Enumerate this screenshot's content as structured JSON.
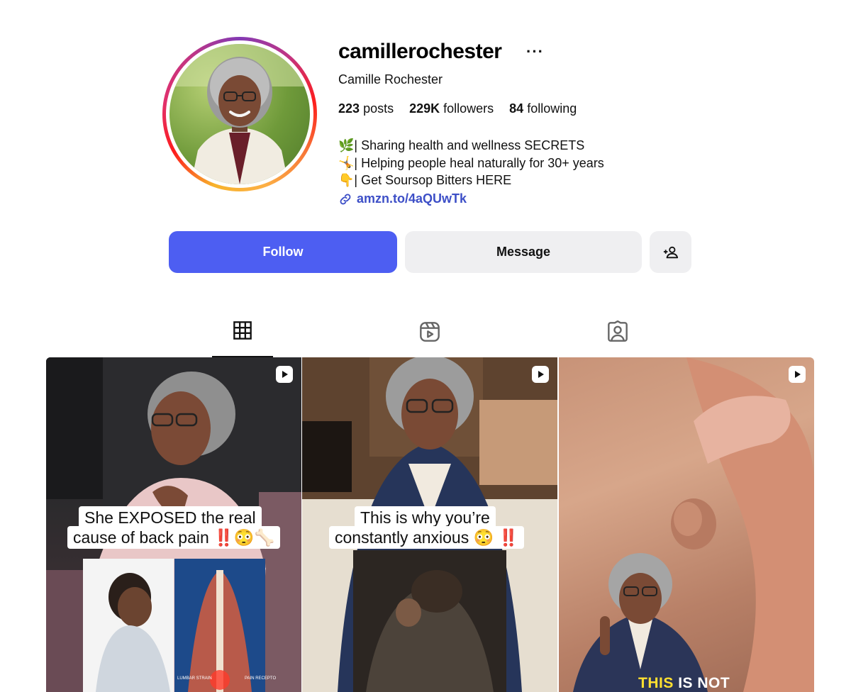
{
  "profile": {
    "username": "camillerochester",
    "more_label": "···",
    "full_name": "Camille Rochester",
    "stats": {
      "posts_count": "223",
      "posts_label": "posts",
      "followers_count": "229K",
      "followers_label": "followers",
      "following_count": "84",
      "following_label": "following"
    },
    "bio": [
      "🌿| Sharing health and wellness SECRETS",
      "🤸| Helping people heal naturally for 30+ years",
      "👇| Get Soursop Bitters HERE"
    ],
    "link_text": "amzn.to/4aQUwTk",
    "link_icon": "link-icon"
  },
  "actions": {
    "follow_label": "Follow",
    "message_label": "Message",
    "suggest_icon": "add-person-icon"
  },
  "tabs": [
    {
      "name": "posts",
      "icon": "grid-icon",
      "active": true
    },
    {
      "name": "reels",
      "icon": "reels-icon",
      "active": false
    },
    {
      "name": "tagged",
      "icon": "tagged-person-icon",
      "active": false
    }
  ],
  "posts": [
    {
      "caption_line1": "She EXPOSED the real",
      "caption_line2": "cause of back pain ‼️😳🦴",
      "image_label_left": "LUMBAR STRAIN",
      "image_label_right": "PAIN RECEPTO",
      "type_icon": "reel-icon"
    },
    {
      "caption_line1": "This is why you’re",
      "caption_line2": "constantly anxious 😳 ‼️",
      "type_icon": "reel-icon"
    },
    {
      "bottom_caption_yellow": "THIS",
      "bottom_caption_white": "IS NOT",
      "type_icon": "reel-icon"
    }
  ],
  "colors": {
    "follow_button": "#4d5ef2",
    "secondary_button": "#efeff1",
    "link": "#3d4fc7"
  }
}
